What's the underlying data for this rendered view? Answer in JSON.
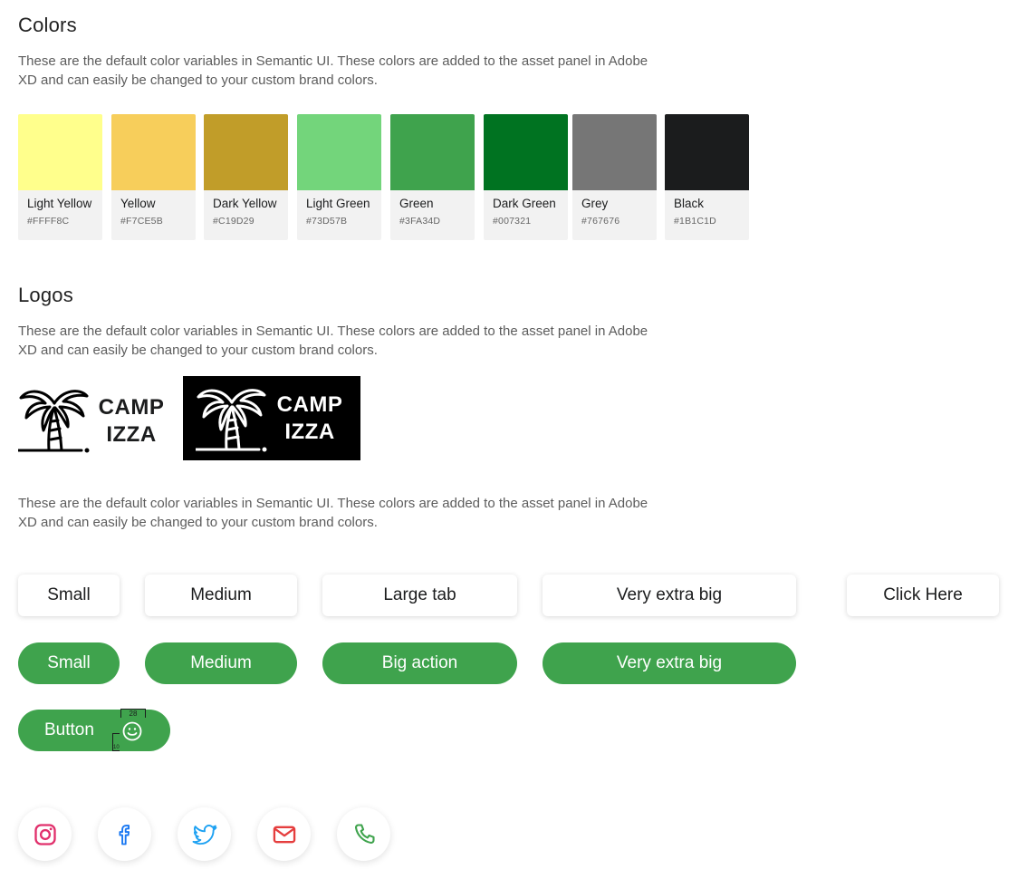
{
  "colors_section": {
    "title": "Colors",
    "description": "These are the default color variables in Semantic UI. These colors are added to the asset panel in Adobe XD and can easily be changed to your custom brand colors.",
    "swatches": [
      {
        "name": "Light Yellow",
        "hex": "#FFFF8C"
      },
      {
        "name": "Yellow",
        "hex": "#F7CE5B"
      },
      {
        "name": "Dark Yellow",
        "hex": "#C19D29"
      },
      {
        "name": "Light Green",
        "hex": "#73D57B"
      },
      {
        "name": "Green",
        "hex": "#3FA34D"
      },
      {
        "name": "Dark Green",
        "hex": "#007321"
      },
      {
        "name": "Grey",
        "hex": "#767676"
      },
      {
        "name": "Black",
        "hex": "#1B1C1D"
      }
    ]
  },
  "logos_section": {
    "title": "Logos",
    "description": "These are the default color variables in Semantic UI. These colors are added to the asset panel in Adobe XD and can easily be changed to your custom brand colors.",
    "logo_line1": "CAMP",
    "logo_line2": "IZZA"
  },
  "buttons_section": {
    "description": "These are the default color variables in Semantic UI. These colors are added to the asset panel in Adobe XD and can easily be changed to your custom brand colors.",
    "tabs": [
      "Small",
      "Medium",
      "Large tab",
      "Very extra big",
      "Click Here"
    ],
    "actions": [
      "Small",
      "Medium",
      "Big action",
      "Very extra big"
    ],
    "icon_button": {
      "label": "Button",
      "measure_width": "28",
      "measure_height": "10"
    }
  },
  "social": {
    "icons": [
      "instagram-icon",
      "facebook-icon",
      "twitter-icon",
      "mail-icon",
      "phone-icon"
    ]
  },
  "brand_colors": {
    "green": "#3FA34D",
    "white": "#FFFFFF"
  }
}
